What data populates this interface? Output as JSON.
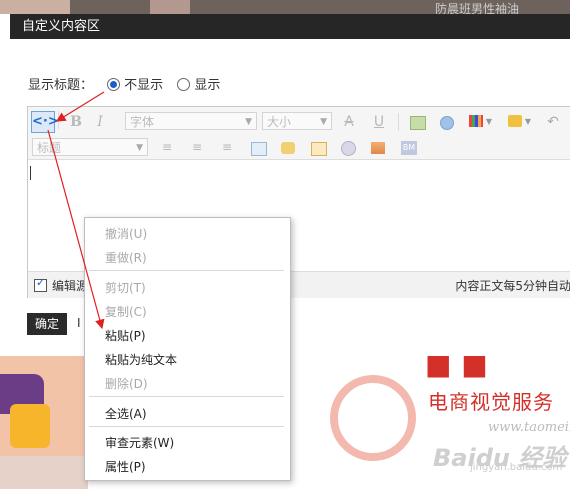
{
  "background": {
    "top_right_text": "防晨班男性袖油",
    "tagline": "电商视觉服务",
    "domain": "www.taomeixh",
    "watermark": "Baidu 经验",
    "watermark_sub": "jingyan.baidu.com"
  },
  "dialog": {
    "title": "自定义内容区",
    "show_title_label": "显示标题：",
    "options": [
      {
        "label": "不显示",
        "selected": true
      },
      {
        "label": "显示",
        "selected": false
      }
    ],
    "toolbar": {
      "font_placeholder": "字体",
      "size_placeholder": "大小",
      "heading_placeholder": "标题",
      "bold": "B",
      "italic": "I",
      "strike": "A",
      "underline": "U",
      "source_icon": "<·>"
    },
    "footer": {
      "edit_source_label": "编辑源",
      "autosave_text": "内容正文每5分钟自动"
    },
    "ok_label": "确定",
    "cancel_hint": "I"
  },
  "context_menu": {
    "items": [
      {
        "label": "撤消(U)",
        "enabled": false
      },
      {
        "label": "重做(R)",
        "enabled": false
      },
      {
        "label": "剪切(T)",
        "enabled": false
      },
      {
        "label": "复制(C)",
        "enabled": false
      },
      {
        "label": "粘贴(P)",
        "enabled": true
      },
      {
        "label": "粘贴为纯文本",
        "enabled": true
      },
      {
        "label": "删除(D)",
        "enabled": false
      },
      {
        "label": "全选(A)",
        "enabled": true
      },
      {
        "label": "审查元素(W)",
        "enabled": true
      },
      {
        "label": "属性(P)",
        "enabled": true
      }
    ]
  },
  "colors": {
    "dialog_title_bg": "#262626",
    "annotation_arrow": "#e02020",
    "primary_button": "#2b2b2b"
  }
}
